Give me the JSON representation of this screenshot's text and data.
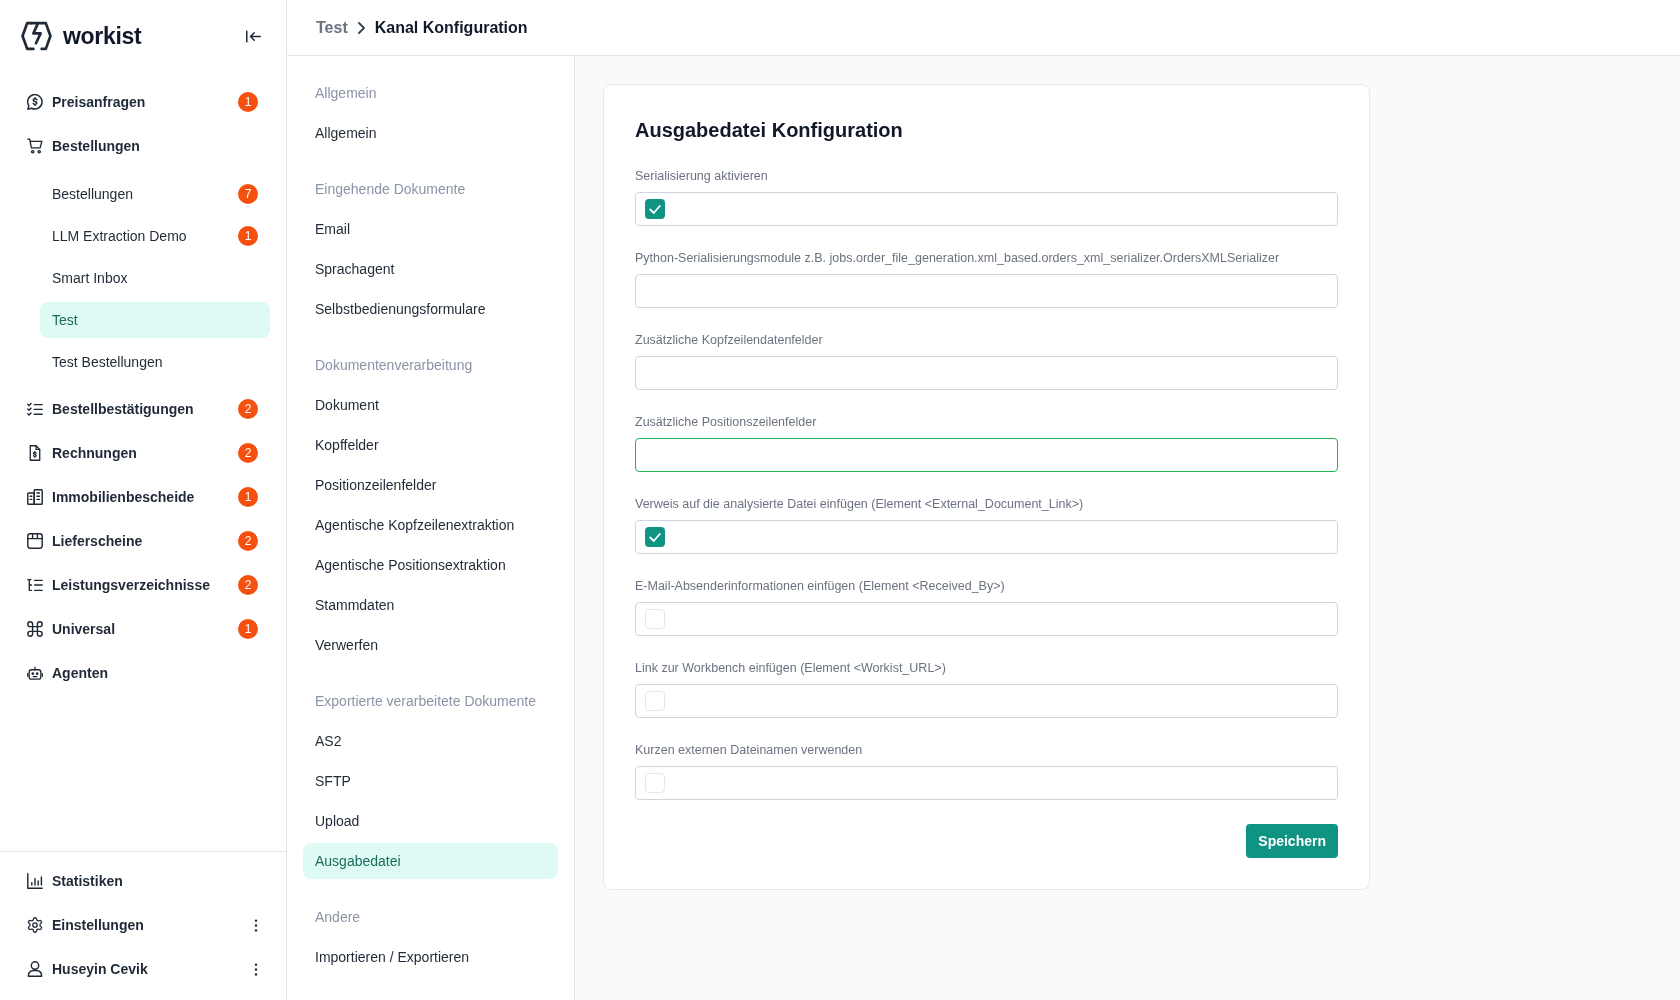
{
  "sidebar": {
    "logo": "workist",
    "nav": [
      {
        "label": "Preisanfragen",
        "badge": "1",
        "selected": false
      },
      {
        "label": "Bestellungen",
        "selected": false,
        "children": [
          {
            "label": "Bestellungen",
            "badge": "7",
            "selected": false
          },
          {
            "label": "LLM Extraction Demo",
            "badge": "1",
            "selected": false
          },
          {
            "label": "Smart Inbox",
            "selected": false
          },
          {
            "label": "Test",
            "selected": true
          },
          {
            "label": "Test Bestellungen",
            "selected": false
          }
        ]
      },
      {
        "label": "Bestellbestätigungen",
        "badge": "2",
        "selected": false
      },
      {
        "label": "Rechnungen",
        "badge": "2",
        "selected": false
      },
      {
        "label": "Immobilienbescheide",
        "badge": "1",
        "selected": false
      },
      {
        "label": "Lieferscheine",
        "badge": "2",
        "selected": false
      },
      {
        "label": "Leistungsverzeichnisse",
        "badge": "2",
        "selected": false
      },
      {
        "label": "Universal",
        "badge": "1",
        "selected": false
      },
      {
        "label": "Agenten",
        "selected": false
      }
    ],
    "footer": [
      {
        "label": "Statistiken",
        "has_menu": false
      },
      {
        "label": "Einstellungen",
        "has_menu": true
      },
      {
        "label": "Huseyin Cevik",
        "has_menu": true
      }
    ]
  },
  "breadcrumb": [
    {
      "label": "Test",
      "current": false
    },
    {
      "label": "Kanal Konfiguration",
      "current": true
    }
  ],
  "settings_nav": {
    "sections": [
      {
        "heading": "Allgemein",
        "items": [
          {
            "label": "Allgemein",
            "selected": false
          }
        ]
      },
      {
        "heading": "Eingehende Dokumente",
        "items": [
          {
            "label": "Email",
            "selected": false
          },
          {
            "label": "Sprachagent",
            "selected": false
          },
          {
            "label": "Selbstbedienungsformulare",
            "selected": false
          }
        ]
      },
      {
        "heading": "Dokumentenverarbeitung",
        "items": [
          {
            "label": "Dokument",
            "selected": false
          },
          {
            "label": "Kopffelder",
            "selected": false
          },
          {
            "label": "Positionzeilenfelder",
            "selected": false
          },
          {
            "label": "Agentische Kopfzeilenextraktion",
            "selected": false
          },
          {
            "label": "Agentische Positionsextraktion",
            "selected": false
          },
          {
            "label": "Stammdaten",
            "selected": false
          },
          {
            "label": "Verwerfen",
            "selected": false
          }
        ]
      },
      {
        "heading": "Exportierte verarbeitete Dokumente",
        "items": [
          {
            "label": "AS2",
            "selected": false
          },
          {
            "label": "SFTP",
            "selected": false
          },
          {
            "label": "Upload",
            "selected": false
          },
          {
            "label": "Ausgabedatei",
            "selected": true
          }
        ]
      },
      {
        "heading": "Andere",
        "items": [
          {
            "label": "Importieren / Exportieren",
            "selected": false
          }
        ]
      }
    ]
  },
  "form": {
    "title": "Ausgabedatei Konfiguration",
    "fields": [
      {
        "kind": "checkbox",
        "label": "Serialisierung aktivieren",
        "checked": true,
        "focused": false
      },
      {
        "kind": "text",
        "label": "Python-Serialisierungsmodule z.B. jobs.order_file_generation.xml_based.orders_xml_serializer.OrdersXMLSerializer",
        "focused": false
      },
      {
        "kind": "text",
        "label": "Zusätzliche Kopfzeilendatenfelder",
        "focused": false
      },
      {
        "kind": "text",
        "label": "Zusätzliche Positionszeilenfelder",
        "focused": true
      },
      {
        "kind": "checkbox",
        "label": "Verweis auf die analysierte Datei einfügen (Element <External_Document_Link>)",
        "checked": true,
        "focused": false
      },
      {
        "kind": "checkbox",
        "label": "E-Mail-Absenderinformationen einfügen (Element <Received_By>)",
        "checked": false,
        "focused": false
      },
      {
        "kind": "checkbox",
        "label": "Link zur Workbench einfügen (Element <Workist_URL>)",
        "checked": false,
        "focused": false
      },
      {
        "kind": "checkbox",
        "label": "Kurzen externen Dateinamen verwenden",
        "checked": false,
        "focused": false
      }
    ],
    "save_button": "Speichern"
  }
}
